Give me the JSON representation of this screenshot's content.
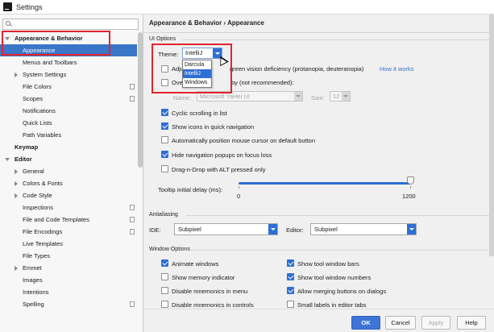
{
  "window": {
    "title": "Settings"
  },
  "search": {
    "placeholder": "",
    "value": ""
  },
  "tree": [
    {
      "label": "Appearance & Behavior",
      "bold": true,
      "expanded": true,
      "level": 0
    },
    {
      "label": "Appearance",
      "selected": true,
      "level": 1
    },
    {
      "label": "Menus and Toolbars",
      "level": 1
    },
    {
      "label": "System Settings",
      "collapsed": true,
      "level": 1
    },
    {
      "label": "File Colors",
      "level": 1,
      "copy": true
    },
    {
      "label": "Scopes",
      "level": 1,
      "copy": true
    },
    {
      "label": "Notifications",
      "level": 1
    },
    {
      "label": "Quick Lists",
      "level": 1
    },
    {
      "label": "Path Variables",
      "level": 1
    },
    {
      "label": "Keymap",
      "bold": true,
      "level": 0
    },
    {
      "label": "Editor",
      "bold": true,
      "expanded": true,
      "level": 0
    },
    {
      "label": "General",
      "collapsed": true,
      "level": 1
    },
    {
      "label": "Colors & Fonts",
      "collapsed": true,
      "level": 1
    },
    {
      "label": "Code Style",
      "collapsed": true,
      "level": 1
    },
    {
      "label": "Inspections",
      "level": 1,
      "copy": true
    },
    {
      "label": "File and Code Templates",
      "level": 1,
      "copy": true
    },
    {
      "label": "File Encodings",
      "level": 1,
      "copy": true
    },
    {
      "label": "Live Templates",
      "level": 1
    },
    {
      "label": "File Types",
      "level": 1
    },
    {
      "label": "Emmet",
      "collapsed": true,
      "level": 1
    },
    {
      "label": "Images",
      "level": 1
    },
    {
      "label": "Intentions",
      "level": 1
    },
    {
      "label": "Spelling",
      "level": 1,
      "copy": true
    }
  ],
  "breadcrumb": "Appearance & Behavior › Appearance",
  "ui_options": {
    "section": "UI Options",
    "theme_label": "Theme:",
    "theme_value": "IntelliJ",
    "theme_options": [
      "Darcula",
      "IntelliJ",
      "Windows"
    ],
    "adjust_colors_prefix": "Adju",
    "adjust_colors_suffix": "green vision deficiency (protanopia, deuteranopia)",
    "how_it_works": "How it works",
    "override_prefix": "Over",
    "override_suffix": "by (not recommended):",
    "name_label": "Name:",
    "font_name": "Microsoft YaHei UI",
    "size_label": "Size:",
    "font_size": "12",
    "cyclic_scrolling": "Cyclic scrolling in list",
    "show_icons": "Show icons in quick navigation",
    "auto_position": "Automatically position mouse cursor on default button",
    "hide_nav": "Hide navigation popups on focus loss",
    "drag_drop": "Drag-n-Drop with ALT pressed only",
    "tooltip_label": "Tooltip initial delay (ms):",
    "tooltip_min": "0",
    "tooltip_max": "1200",
    "tooltip_value": 1200
  },
  "antialiasing": {
    "section": "Antialiasing",
    "ide_label": "IDE:",
    "ide_value": "Subpixel",
    "editor_label": "Editor:",
    "editor_value": "Subpixel"
  },
  "window_options": {
    "section": "Window Options",
    "animate": "Animate windows",
    "show_memory": "Show memory indicator",
    "disable_mnemonics_menu": "Disable mnemonics in menu",
    "disable_mnemonics_controls": "Disable mnemonics in controls",
    "show_tool_bars": "Show tool window bars",
    "show_tool_numbers": "Show tool window numbers",
    "allow_merging": "Allow merging buttons on dialogs",
    "small_labels": "Small labels in editor tabs"
  },
  "buttons": {
    "ok": "OK",
    "cancel": "Cancel",
    "apply": "Apply",
    "help": "Help"
  },
  "colors": {
    "accent": "#2d6fd4",
    "selection": "#3b75c7",
    "highlight": "#e0242c",
    "link": "#3b6fc4"
  }
}
